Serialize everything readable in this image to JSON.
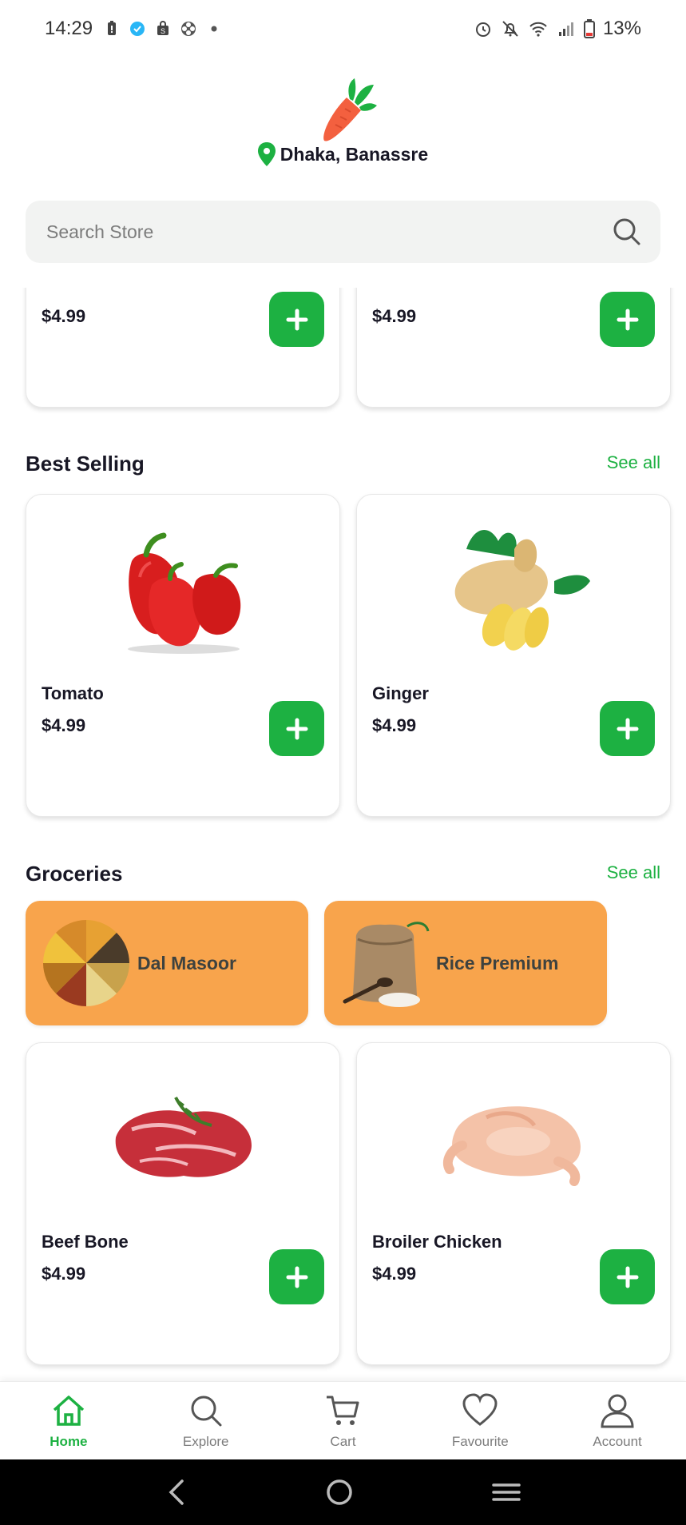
{
  "status_bar": {
    "time": "14:29",
    "battery": "13%",
    "left_icons": [
      "battery-saver-icon",
      "verified-icon",
      "shopping-bag-icon",
      "pinwheel-icon",
      "dot-icon"
    ],
    "right_icons": [
      "alarm-icon",
      "notifications-off-icon",
      "wifi-icon",
      "signal-icon",
      "battery-icon"
    ]
  },
  "header": {
    "logo": "carrot-logo",
    "location": "Dhaka, Banassre"
  },
  "search": {
    "placeholder": "Search Store"
  },
  "top_partial_products": [
    {
      "name": "",
      "price": "$4.99"
    },
    {
      "name": "",
      "price": "$4.99"
    }
  ],
  "best_selling": {
    "title": "Best Selling",
    "see_all": "See all",
    "products": [
      {
        "name": "Tomato",
        "price": "$4.99",
        "image": "red-pepper"
      },
      {
        "name": "Ginger",
        "price": "$4.99",
        "image": "ginger"
      }
    ]
  },
  "groceries": {
    "title": "Groceries",
    "see_all": "See all",
    "categories": [
      {
        "label": "Dal Masoor",
        "image": "lentils"
      },
      {
        "label": "Rice Premium",
        "image": "rice-sack"
      }
    ],
    "products": [
      {
        "name": "Beef Bone",
        "price": "$4.99",
        "image": "beef"
      },
      {
        "name": "Broiler Chicken",
        "price": "$4.99",
        "image": "chicken"
      }
    ]
  },
  "bottom_nav": {
    "items": [
      {
        "label": "Home",
        "icon": "home-icon",
        "active": true
      },
      {
        "label": "Explore",
        "icon": "search-icon",
        "active": false
      },
      {
        "label": "Cart",
        "icon": "cart-icon",
        "active": false
      },
      {
        "label": "Favourite",
        "icon": "heart-icon",
        "active": false
      },
      {
        "label": "Account",
        "icon": "user-icon",
        "active": false
      }
    ]
  },
  "colors": {
    "accent": "#1db142",
    "grocery_chip": "#f8a44c",
    "search_bg": "#f2f3f2",
    "location_pin": "#1db142"
  }
}
